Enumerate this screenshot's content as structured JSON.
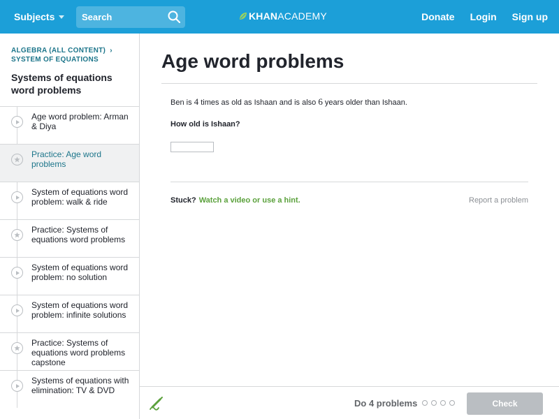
{
  "header": {
    "subjects_label": "Subjects",
    "search_placeholder": "Search",
    "logo_bold": "KHAN",
    "logo_light": "ACADEMY",
    "nav": [
      "Donate",
      "Login",
      "Sign up"
    ],
    "bar_color": "#1c9fd8"
  },
  "sidebar": {
    "breadcrumb_course": "ALGEBRA (ALL CONTENT)",
    "breadcrumb_unit": "SYSTEM OF EQUATIONS",
    "unit_title": "Systems of equations word problems",
    "items": [
      {
        "label": "Age word problem: Arman & Diya",
        "kind": "video"
      },
      {
        "label": "Practice: Age word problems",
        "kind": "practice"
      },
      {
        "label": "System of equations word problem: walk & ride",
        "kind": "video"
      },
      {
        "label": "Practice: Systems of equations word problems",
        "kind": "practice"
      },
      {
        "label": "System of equations word problem: no solution",
        "kind": "video"
      },
      {
        "label": "System of equations word problem: infinite solutions",
        "kind": "video"
      },
      {
        "label": "Practice: Systems of equations word problems capstone",
        "kind": "practice"
      },
      {
        "label": "Systems of equations with elimination: TV & DVD",
        "kind": "video"
      }
    ],
    "active_index": 1
  },
  "main": {
    "title": "Age word problems",
    "question": {
      "part1": "Ben is ",
      "n1": "4",
      "part2": " times as old as Ishaan and is also ",
      "n2": "6",
      "part3": " years older than Ishaan."
    },
    "prompt": "How old is Ishaan?",
    "answer_value": "",
    "stuck_label": "Stuck?",
    "hint_label": "Watch a video or use a hint.",
    "report_label": "Report a problem"
  },
  "footer": {
    "do_label": "Do 4 problems",
    "problems_total": 4,
    "problems_done": 0,
    "check_label": "Check"
  }
}
